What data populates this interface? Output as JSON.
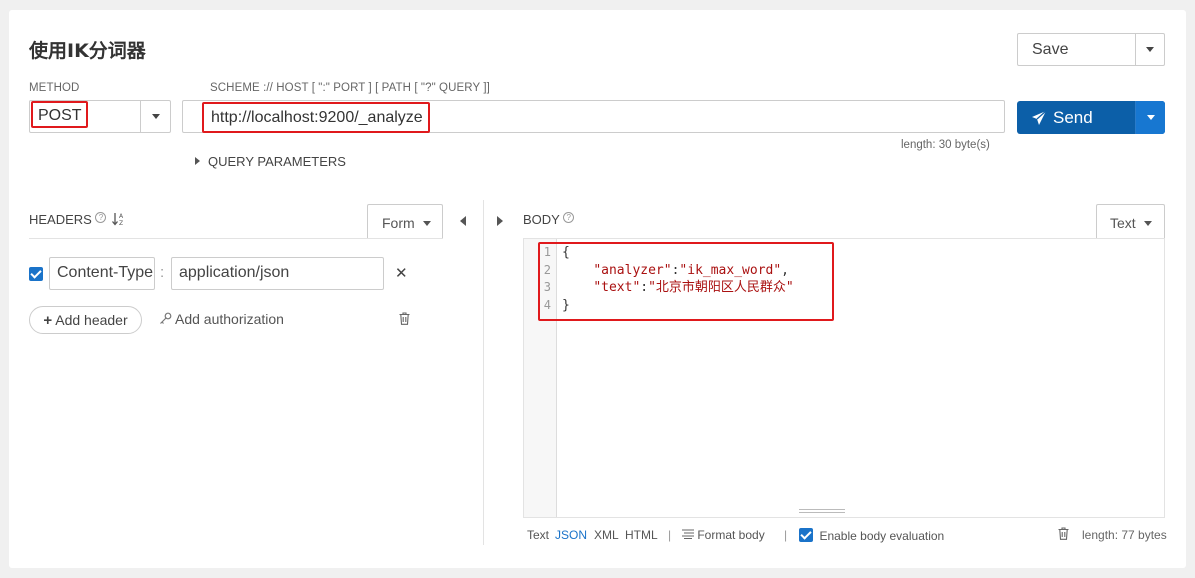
{
  "header": {
    "title": "使用IK分词器",
    "save_label": "Save"
  },
  "method": {
    "label": "METHOD",
    "value": "POST"
  },
  "url": {
    "label": "SCHEME :// HOST [ \":\" PORT ] [ PATH [ \"?\" QUERY ]]",
    "value": "http://localhost:9200/_analyze",
    "length_text": "length: 30 byte(s)"
  },
  "send": {
    "label": "Send"
  },
  "query": {
    "label": "QUERY PARAMETERS"
  },
  "headers": {
    "label": "HEADERS",
    "form_label": "Form",
    "row": {
      "name": "Content-Type",
      "separator": ":",
      "value": "application/json"
    },
    "add_header_label": "Add header",
    "add_auth_label": "Add authorization"
  },
  "body": {
    "label": "BODY",
    "text_label": "Text",
    "line_numbers": [
      "1",
      "2",
      "3",
      "4"
    ],
    "code": {
      "line1": "{",
      "line2_indent": "    ",
      "line2_key": "\"analyzer\"",
      "line2_colon": ":",
      "line2_val": "\"ik_max_word\"",
      "line2_comma": ",",
      "line3_indent": "    ",
      "line3_key": "\"text\"",
      "line3_colon": ":",
      "line3_val": "\"北京市朝阳区人民群众\"",
      "line4": "}"
    },
    "footer": {
      "text": "Text",
      "json": "JSON",
      "xml": "XML",
      "html": "HTML",
      "sep": "|",
      "format_body": "Format body",
      "enable_eval": "Enable body evaluation",
      "length": "length: 77 bytes"
    }
  },
  "colors": {
    "accent": "#0c5fa8",
    "highlight": "#e0191c",
    "link": "#1a73c9"
  }
}
